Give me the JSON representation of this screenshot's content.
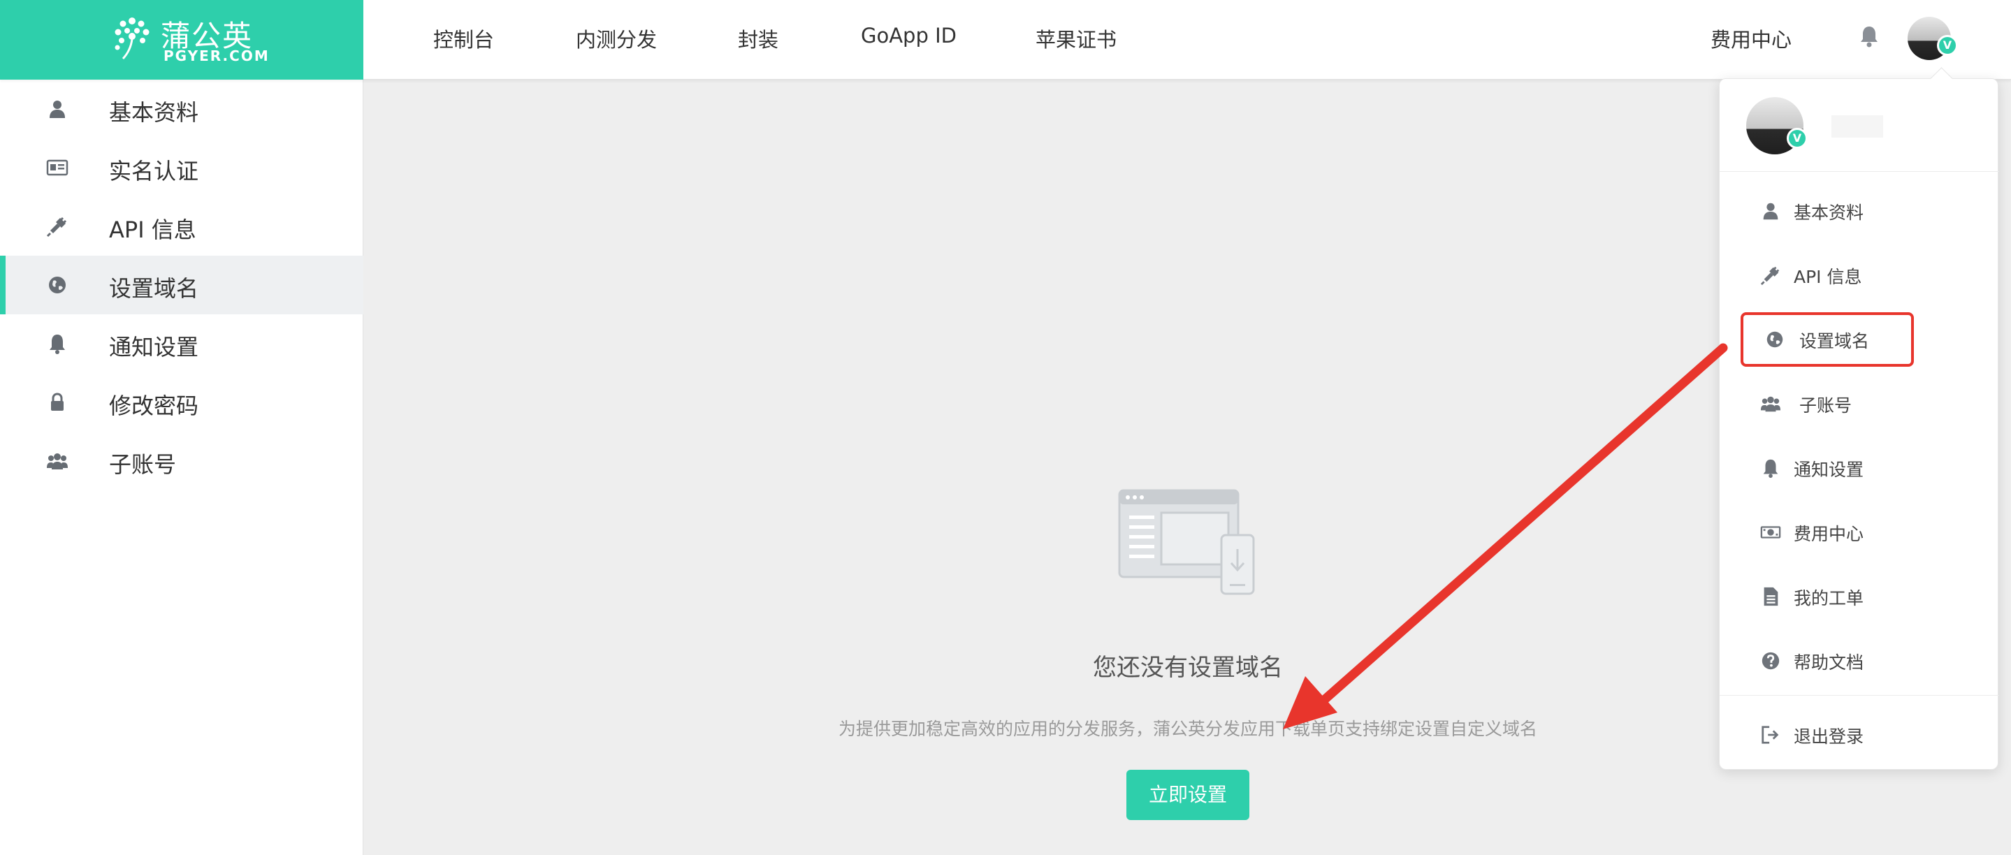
{
  "brand": {
    "name_cn": "蒲公英",
    "name_en": "PGYER.COM",
    "accent": "#2ecfab"
  },
  "topnav": {
    "items": [
      {
        "label": "控制台"
      },
      {
        "label": "内测分发"
      },
      {
        "label": "封装"
      },
      {
        "label": "GoApp ID"
      },
      {
        "label": "苹果证书"
      }
    ],
    "billing": "费用中心",
    "badge_letter": "V"
  },
  "sidebar": {
    "items": [
      {
        "label": "基本资料",
        "icon": "user-icon"
      },
      {
        "label": "实名认证",
        "icon": "id-card-icon"
      },
      {
        "label": "API 信息",
        "icon": "plug-icon"
      },
      {
        "label": "设置域名",
        "icon": "globe-icon",
        "active": true
      },
      {
        "label": "通知设置",
        "icon": "bell-icon"
      },
      {
        "label": "修改密码",
        "icon": "lock-icon"
      },
      {
        "label": "子账号",
        "icon": "users-icon"
      }
    ]
  },
  "main": {
    "empty_title": "您还没有设置域名",
    "empty_desc": "为提供更加稳定高效的应用的分发服务，蒲公英分发应用下载单页支持绑定设置自定义域名",
    "setup_button": "立即设置"
  },
  "dropdown": {
    "items": [
      {
        "label": "基本资料",
        "icon": "user-icon"
      },
      {
        "label": "API 信息",
        "icon": "plug-icon"
      },
      {
        "label": "设置域名",
        "icon": "globe-icon",
        "highlighted": true
      },
      {
        "label": "子账号",
        "icon": "users-icon"
      },
      {
        "label": "通知设置",
        "icon": "bell-icon"
      },
      {
        "label": "费用中心",
        "icon": "money-icon"
      },
      {
        "label": "我的工单",
        "icon": "document-icon"
      },
      {
        "label": "帮助文档",
        "icon": "question-icon"
      },
      {
        "label": "退出登录",
        "icon": "logout-icon"
      }
    ]
  },
  "annotation": {
    "arrow_color": "#e8352c"
  }
}
